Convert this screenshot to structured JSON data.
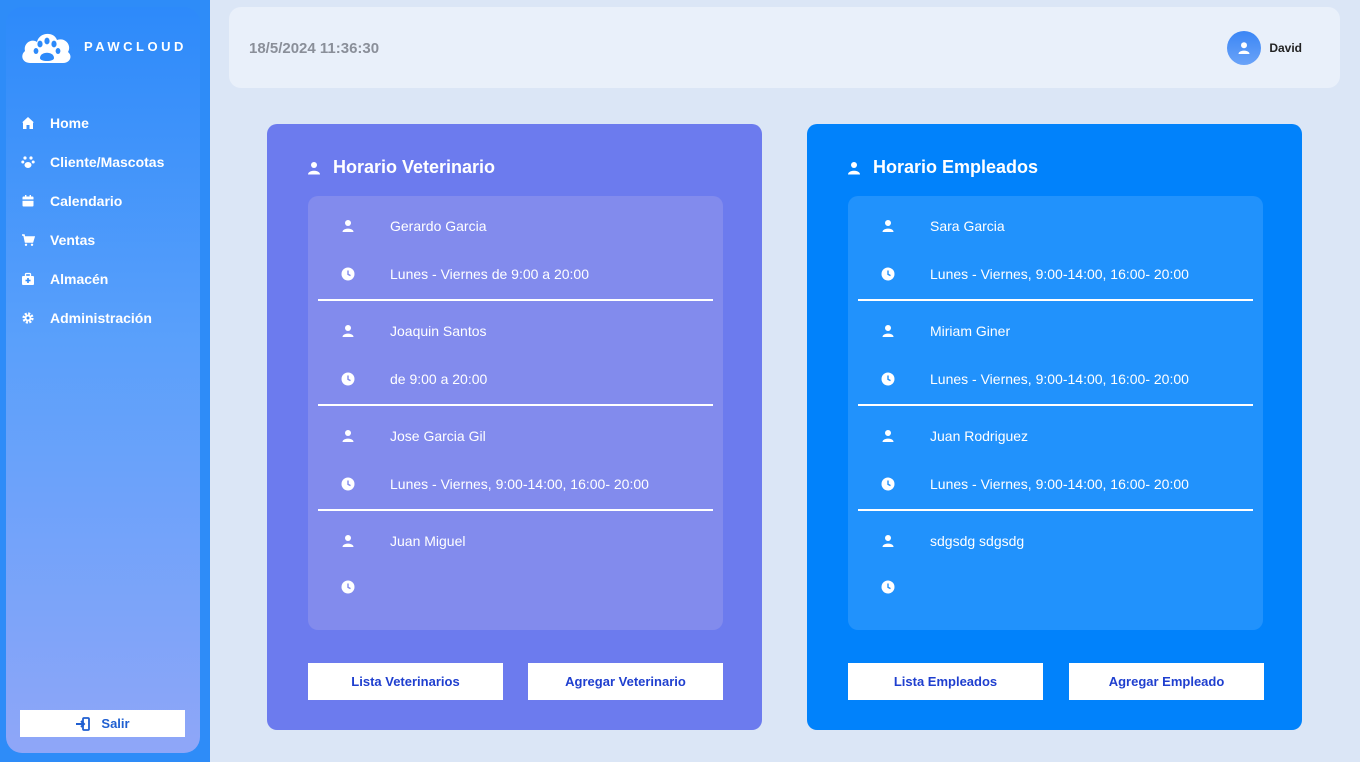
{
  "app": {
    "name": "PAWCLOUD"
  },
  "sidebar": {
    "items": [
      {
        "label": "Home",
        "icon": "home-icon"
      },
      {
        "label": "Cliente/Mascotas",
        "icon": "paw-icon"
      },
      {
        "label": "Calendario",
        "icon": "calendar-icon"
      },
      {
        "label": "Ventas",
        "icon": "cart-icon"
      },
      {
        "label": "Almacén",
        "icon": "medkit-icon"
      },
      {
        "label": "Administración",
        "icon": "gear-icon"
      }
    ],
    "logout_label": "Salir"
  },
  "header": {
    "datetime": "18/5/2024 11:36:30",
    "user_name": "David"
  },
  "vet_card": {
    "title": "Horario Veterinario",
    "entries": [
      {
        "name": "Gerardo Garcia",
        "schedule": "Lunes - Viernes de 9:00 a 20:00"
      },
      {
        "name": "Joaquin Santos",
        "schedule": "de 9:00 a 20:00"
      },
      {
        "name": "Jose Garcia Gil",
        "schedule": "Lunes - Viernes, 9:00-14:00, 16:00- 20:00"
      },
      {
        "name": "Juan Miguel",
        "schedule": ""
      }
    ],
    "list_button": "Lista Veterinarios",
    "add_button": "Agregar Veterinario"
  },
  "emp_card": {
    "title": "Horario Empleados",
    "entries": [
      {
        "name": "Sara Garcia",
        "schedule": "Lunes - Viernes, 9:00-14:00, 16:00- 20:00"
      },
      {
        "name": "Miriam Giner",
        "schedule": "Lunes - Viernes, 9:00-14:00, 16:00- 20:00"
      },
      {
        "name": "Juan Rodriguez",
        "schedule": "Lunes - Viernes, 9:00-14:00, 16:00- 20:00"
      },
      {
        "name": "sdgsdg sdgsdg",
        "schedule": ""
      }
    ],
    "list_button": "Lista Empleados",
    "add_button": "Agregar Empleado"
  },
  "colors": {
    "sidebar_top": "#2d8afa",
    "sidebar_bottom": "#8fa6f8",
    "vet_card": "#6c7bee",
    "emp_card": "#0182fb",
    "button_text": "#1f3fcf",
    "main_bg": "#dbe6f6"
  }
}
